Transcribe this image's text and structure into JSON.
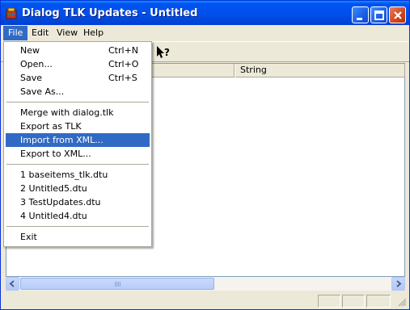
{
  "window": {
    "title": "Dialog TLK Updates - Untitled"
  },
  "menubar": {
    "items": [
      "File",
      "Edit",
      "View",
      "Help"
    ]
  },
  "list": {
    "columns": [
      "",
      "String"
    ]
  },
  "file_menu": {
    "items": [
      {
        "label": "New",
        "shortcut": "Ctrl+N"
      },
      {
        "label": "Open...",
        "shortcut": "Ctrl+O"
      },
      {
        "label": "Save",
        "shortcut": "Ctrl+S"
      },
      {
        "label": "Save As...",
        "shortcut": ""
      },
      {
        "label": "Merge with dialog.tlk",
        "shortcut": ""
      },
      {
        "label": "Export as TLK",
        "shortcut": ""
      },
      {
        "label": "Import from XML...",
        "shortcut": ""
      },
      {
        "label": "Export to XML...",
        "shortcut": ""
      },
      {
        "label": "1 baseitems_tlk.dtu",
        "shortcut": ""
      },
      {
        "label": "2 Untitled5.dtu",
        "shortcut": ""
      },
      {
        "label": "3 TestUpdates.dtu",
        "shortcut": ""
      },
      {
        "label": "4 Untitled4.dtu",
        "shortcut": ""
      },
      {
        "label": "Exit",
        "shortcut": ""
      }
    ],
    "highlighted": "Import from XML..."
  },
  "colors": {
    "title_gradient_top": "#0997ff",
    "title_gradient_bottom": "#003dd7",
    "selection": "#316ac5",
    "close_button": "#d2441e"
  },
  "icons": {
    "app": "app-icon",
    "help_tool": "context-help-icon"
  }
}
